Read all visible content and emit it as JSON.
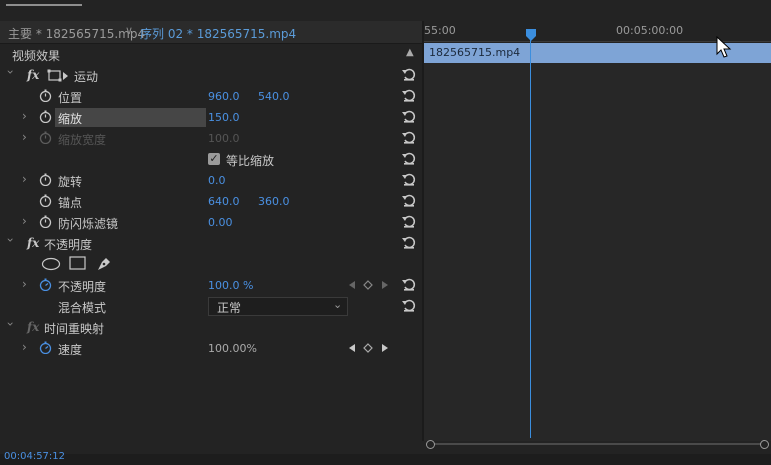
{
  "tabs": {
    "source": "主要 * 182565715.mp4",
    "sequence_arrow": "∨",
    "sequence": "序列 02 * 182565715.mp4"
  },
  "panel": {
    "header": "视频效果",
    "collapse_glyph": "▲"
  },
  "motion": {
    "fx": "fx",
    "label": "运动",
    "position": {
      "label": "位置",
      "x": "960.0",
      "y": "540.0"
    },
    "scale": {
      "label": "缩放",
      "value": "150.0"
    },
    "scale_width": {
      "label": "缩放宽度",
      "value": "100.0"
    },
    "uniform_scale": {
      "label": "等比缩放",
      "checked": true
    },
    "rotation": {
      "label": "旋转",
      "value": "0.0"
    },
    "anchor": {
      "label": "锚点",
      "x": "640.0",
      "y": "360.0"
    },
    "antiflicker": {
      "label": "防闪烁滤镜",
      "value": "0.00"
    }
  },
  "opacity": {
    "fx": "fx",
    "label": "不透明度",
    "value_label": "不透明度",
    "value": "100.0 %",
    "blend_label": "混合模式",
    "blend_value": "正常"
  },
  "time_remap": {
    "fx": "fx",
    "label": "时间重映射",
    "speed_label": "速度",
    "speed_value": "100.00%"
  },
  "timeline": {
    "tc_start": "55:00",
    "tc_mid": "00:05:00:00",
    "clip_name": "182565715.mp4",
    "colors": {
      "clip": "#7ea4d6",
      "playhead": "#3b8ede"
    }
  },
  "footer": {
    "timecode": "00:04:57:12"
  },
  "icons": [
    "chevron-right-icon",
    "stopwatch-icon",
    "reset-icon",
    "checkbox-icon",
    "ellipse-mask-icon",
    "rect-mask-icon",
    "pen-mask-icon",
    "keyframe-prev-icon",
    "keyframe-add-icon",
    "keyframe-next-icon",
    "mouse-cursor-icon"
  ]
}
